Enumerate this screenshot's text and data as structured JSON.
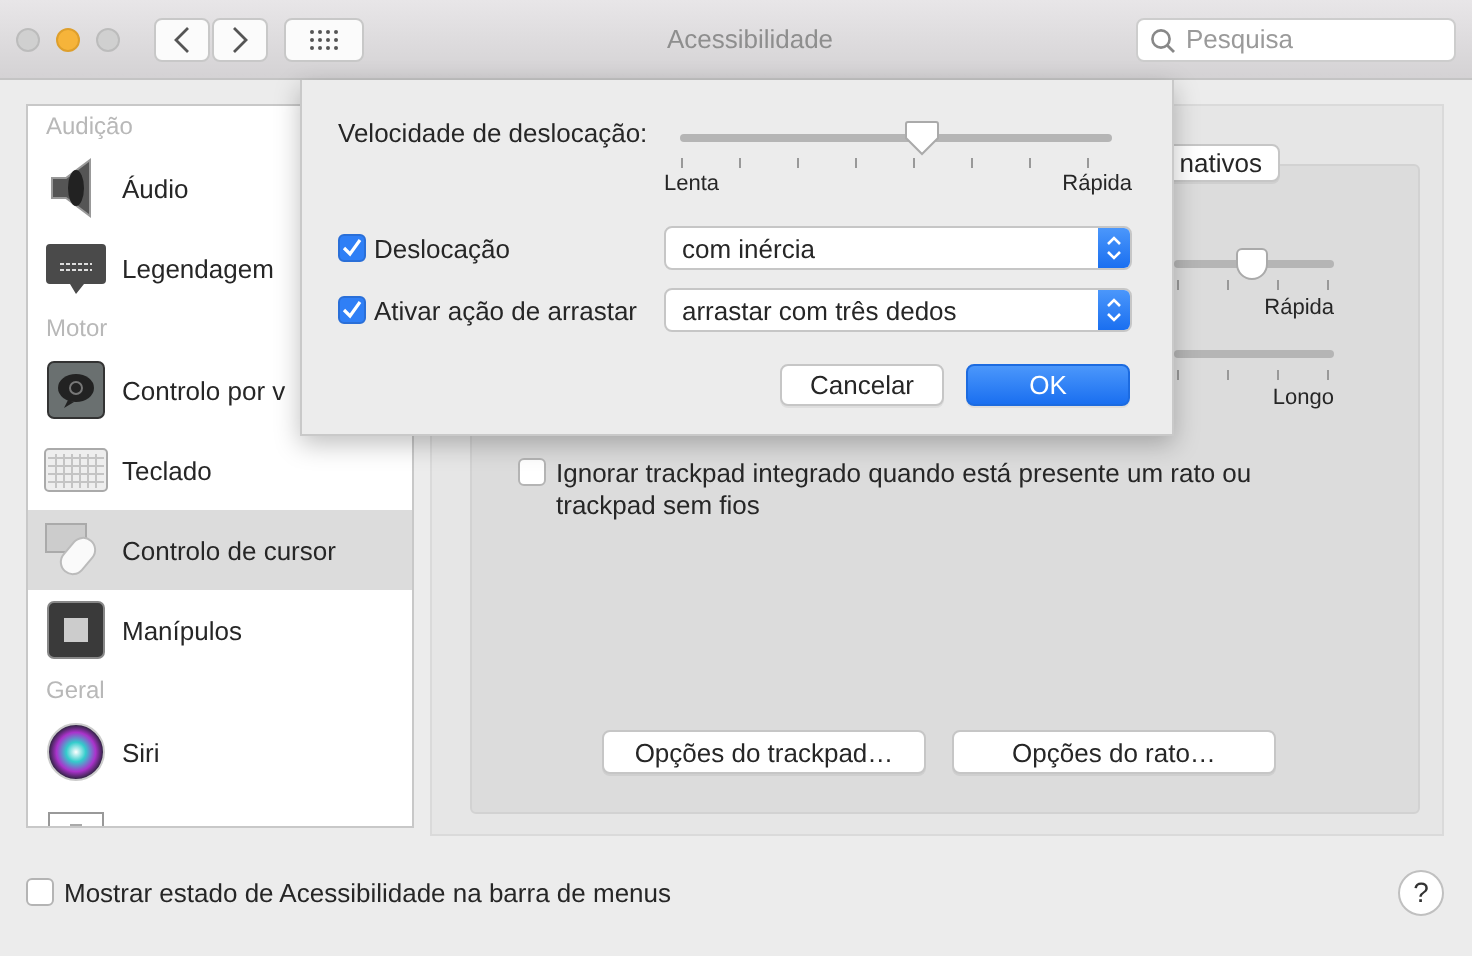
{
  "window": {
    "title": "Acessibilidade"
  },
  "search": {
    "placeholder": "Pesquisa"
  },
  "sidebar": {
    "items": [
      {
        "kind": "header",
        "label": "Audição"
      },
      {
        "kind": "item",
        "label": "Áudio",
        "selected": false
      },
      {
        "kind": "item",
        "label": "Legendagem",
        "selected": false
      },
      {
        "kind": "header",
        "label": "Motor"
      },
      {
        "kind": "item",
        "label": "Controlo por v",
        "selected": false
      },
      {
        "kind": "item",
        "label": "Teclado",
        "selected": false
      },
      {
        "kind": "item",
        "label": "Controlo de cursor",
        "selected": true
      },
      {
        "kind": "item",
        "label": "Manípulos",
        "selected": false
      },
      {
        "kind": "header",
        "label": "Geral"
      },
      {
        "kind": "item",
        "label": "Siri",
        "selected": false
      },
      {
        "kind": "partial"
      }
    ]
  },
  "panel": {
    "tab_button": "nativos",
    "sliders": [
      {
        "label": "Rápida",
        "level": 0.49
      },
      {
        "label": "Longo"
      }
    ],
    "ignore_trackpad": {
      "label": "Ignorar trackpad integrado quando está presente um rato ou trackpad sem fios",
      "checked": false
    },
    "buttons": [
      "Opções do trackpad…",
      "Opções do rato…"
    ]
  },
  "footer": {
    "show_status": {
      "label": "Mostrar estado de Acessibilidade na barra de menus",
      "checked": false
    },
    "help": "?"
  },
  "sheet": {
    "speed_label": "Velocidade de deslocação:",
    "speed": {
      "level": 0.56,
      "min_label": "Lenta",
      "max_label": "Rápida"
    },
    "rows": [
      {
        "label": "Deslocação",
        "checked": true,
        "value": "com inércia"
      },
      {
        "label": "Ativar ação de arrastar",
        "checked": true,
        "value": "arrastar com três dedos"
      }
    ],
    "cancel": "Cancelar",
    "ok": "OK"
  }
}
